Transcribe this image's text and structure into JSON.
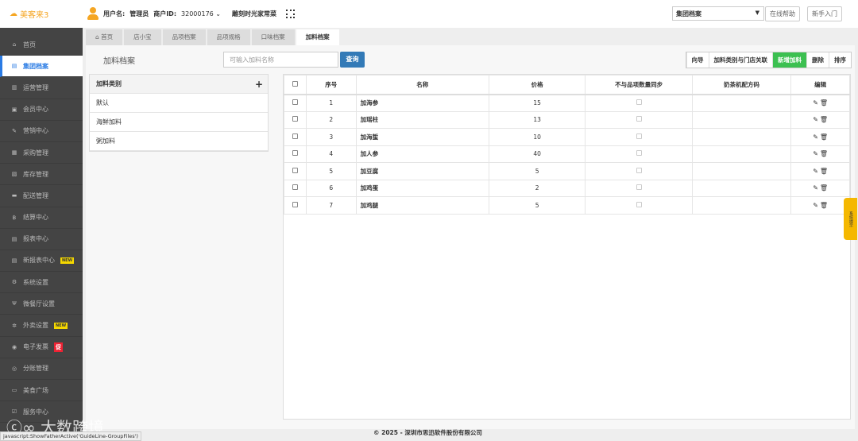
{
  "header": {
    "logo": "美客来3",
    "username_label": "用户名:",
    "username": "管理员",
    "merchant_label": "商户ID:",
    "merchant_id": "32000176",
    "store": "雕刻时光家常菜",
    "select_value": "集团档案",
    "help": "在线帮助",
    "guide": "新手入门"
  },
  "sidebar": {
    "items": [
      {
        "label": "首页",
        "icon": "home-icon",
        "glyph": "⌂"
      },
      {
        "label": "集团档案",
        "icon": "file-icon",
        "glyph": "▤",
        "active": true
      },
      {
        "label": "运营管理",
        "icon": "chart-icon",
        "glyph": "▥"
      },
      {
        "label": "会员中心",
        "icon": "id-card-icon",
        "glyph": "▣"
      },
      {
        "label": "营销中心",
        "icon": "edit-icon",
        "glyph": "✎"
      },
      {
        "label": "采购管理",
        "icon": "cart-icon",
        "glyph": "▦"
      },
      {
        "label": "库存管理",
        "icon": "box-icon",
        "glyph": "▧"
      },
      {
        "label": "配送管理",
        "icon": "truck-icon",
        "glyph": "▬"
      },
      {
        "label": "结算中心",
        "icon": "bitcoin-icon",
        "glyph": "฿"
      },
      {
        "label": "报表中心",
        "icon": "report-icon",
        "glyph": "▤"
      },
      {
        "label": "新报表中心",
        "icon": "report-icon",
        "glyph": "▤",
        "badge": "NEW"
      },
      {
        "label": "系统设置",
        "icon": "cogs-icon",
        "glyph": "⚙"
      },
      {
        "label": "微餐厅设置",
        "icon": "cutlery-icon",
        "glyph": "Ψ"
      },
      {
        "label": "外卖设置",
        "icon": "gear-icon",
        "glyph": "✲",
        "badge": "NEW"
      },
      {
        "label": "电子发票",
        "icon": "invoice-icon",
        "glyph": "◉",
        "badge": "促",
        "badge_red": true
      },
      {
        "label": "分账管理",
        "icon": "yen-icon",
        "glyph": "◎"
      },
      {
        "label": "美食广场",
        "icon": "monitor-icon",
        "glyph": "▭"
      },
      {
        "label": "服务中心",
        "icon": "check-square-icon",
        "glyph": "☑"
      }
    ]
  },
  "tabs": [
    {
      "label": "首页",
      "icon": "home-icon"
    },
    {
      "label": "店小宝"
    },
    {
      "label": "品项档案"
    },
    {
      "label": "品项规格"
    },
    {
      "label": "口味档案"
    },
    {
      "label": "加料档案",
      "active": true
    }
  ],
  "main": {
    "title": "加料档案",
    "search_placeholder": "可输入加料名称",
    "query": "查询",
    "toolbar": [
      "向导",
      "加料类别与门店关联",
      "新增加料",
      "删除",
      "排序"
    ],
    "categories_header": "加料类别",
    "categories": [
      "默认",
      "海鲜加料",
      "粥加料"
    ],
    "columns": [
      "序号",
      "名称",
      "价格",
      "不与品项数量同步",
      "奶茶机配方码",
      "编辑"
    ],
    "rows": [
      [
        "1",
        "加海参",
        "15"
      ],
      [
        "2",
        "加瑶柱",
        "13"
      ],
      [
        "3",
        "加海蜇",
        "10"
      ],
      [
        "4",
        "加人参",
        "40"
      ],
      [
        "5",
        "加豆腐",
        "5"
      ],
      [
        "6",
        "加鸡蛋",
        "2"
      ],
      [
        "7",
        "加鸡腿",
        "5"
      ]
    ]
  },
  "footer": "© 2025 - 深圳市思迅软件股份有限公司",
  "status": "javascript:ShowFatherActive('GuideLine-GroupFiles')",
  "side_tip": "系统提示",
  "watermark": "大数跨境",
  "colors": {
    "accent": "#2a7be4",
    "sidebar": "#444444",
    "add_button": "#3cc051",
    "query_button": "#337ab7",
    "tip": "#f5b800"
  }
}
